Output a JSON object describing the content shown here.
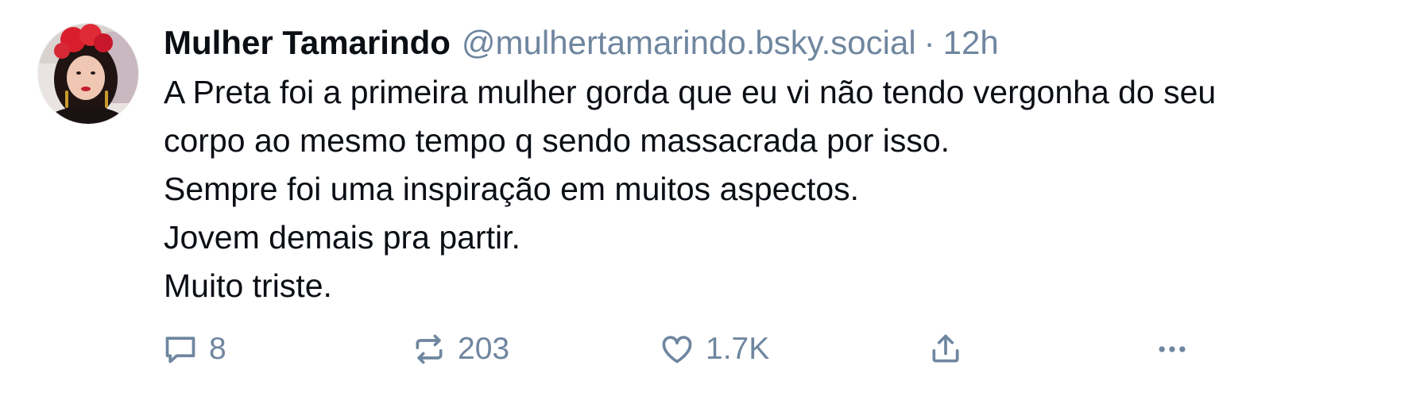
{
  "post": {
    "author": {
      "display_name": "Mulher Tamarindo",
      "handle": "@mulhertamarindo.bsky.social",
      "separator": "·",
      "time": "12h"
    },
    "text_lines": [
      "A Preta foi a primeira mulher gorda que eu vi não tendo vergonha do seu",
      "corpo ao mesmo tempo q sendo massacrada por isso.",
      "Sempre foi uma inspiração em muitos aspectos.",
      "Jovem demais pra partir.",
      "Muito triste."
    ],
    "actions": {
      "reply": {
        "icon": "reply-bubble-icon",
        "count": "8"
      },
      "repost": {
        "icon": "repost-icon",
        "count": "203"
      },
      "like": {
        "icon": "heart-icon",
        "count": "1.7K"
      },
      "share": {
        "icon": "share-icon"
      },
      "more": {
        "icon": "more-dots-icon"
      }
    }
  },
  "colors": {
    "text": "#0b0f14",
    "muted": "#6f869f",
    "background": "#ffffff"
  }
}
